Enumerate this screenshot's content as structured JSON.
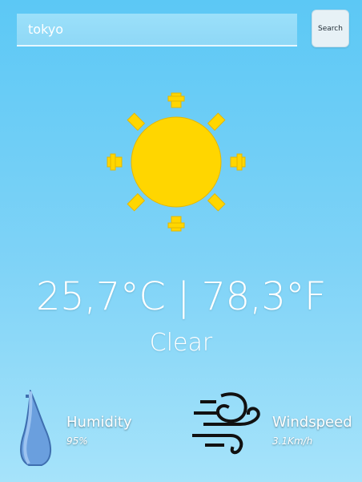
{
  "search": {
    "value": "tokyo",
    "button_label": "Search"
  },
  "weather": {
    "temperature": "25,7°C | 78,3°F",
    "condition": "Clear",
    "icon": "sun-icon"
  },
  "humidity": {
    "label": "Humidity",
    "value": "95%",
    "icon": "water-drop-icon"
  },
  "windspeed": {
    "label": "Windspeed",
    "value": "3.1Km/h",
    "icon": "wind-icon"
  },
  "colors": {
    "sun": "#ffd600",
    "drop": "#6a9fde",
    "sky_top": "#5cc8f5",
    "sky_bottom": "#a6e3fa"
  }
}
